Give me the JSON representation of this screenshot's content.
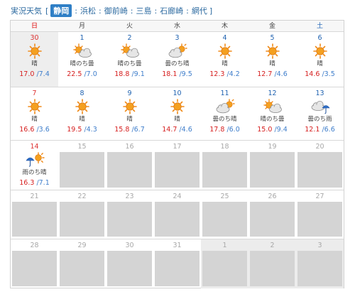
{
  "topbar": {
    "title": "実況天気",
    "open_bracket": "[",
    "close_bracket": "]",
    "locations": [
      {
        "label": "静岡",
        "active": true
      },
      {
        "label": "浜松",
        "active": false
      },
      {
        "label": "御前崎",
        "active": false
      },
      {
        "label": "三島",
        "active": false
      },
      {
        "label": "石廊崎",
        "active": false
      },
      {
        "label": "網代",
        "active": false
      }
    ],
    "separator": ":"
  },
  "weekdays": [
    "日",
    "月",
    "火",
    "水",
    "木",
    "金",
    "土"
  ],
  "weeks": [
    [
      {
        "date": "30",
        "icon": "sun",
        "weather": "晴",
        "high": "17.0",
        "low": "/7.4",
        "today": true
      },
      {
        "date": "1",
        "icon": "sun-cloud",
        "weather": "晴のち曇",
        "high": "22.5",
        "low": "/7.0"
      },
      {
        "date": "2",
        "icon": "sun-cloud",
        "weather": "晴のち曇",
        "high": "18.8",
        "low": "/9.1"
      },
      {
        "date": "3",
        "icon": "cloud-sun",
        "weather": "曇のち晴",
        "high": "18.1",
        "low": "/9.5"
      },
      {
        "date": "4",
        "icon": "sun",
        "weather": "晴",
        "high": "12.3",
        "low": "/4.2"
      },
      {
        "date": "5",
        "icon": "sun",
        "weather": "晴",
        "high": "12.7",
        "low": "/4.6"
      },
      {
        "date": "6",
        "icon": "sun",
        "weather": "晴",
        "high": "14.6",
        "low": "/3.5"
      }
    ],
    [
      {
        "date": "7",
        "icon": "sun",
        "weather": "晴",
        "high": "16.6",
        "low": "/3.6"
      },
      {
        "date": "8",
        "icon": "sun",
        "weather": "晴",
        "high": "19.5",
        "low": "/4.3"
      },
      {
        "date": "9",
        "icon": "sun",
        "weather": "晴",
        "high": "15.8",
        "low": "/6.7"
      },
      {
        "date": "10",
        "icon": "sun",
        "weather": "晴",
        "high": "14.7",
        "low": "/4.6"
      },
      {
        "date": "11",
        "icon": "cloud-sun",
        "weather": "曇のち晴",
        "high": "17.8",
        "low": "/6.0"
      },
      {
        "date": "12",
        "icon": "sun-cloud",
        "weather": "晴のち曇",
        "high": "15.0",
        "low": "/9.4"
      },
      {
        "date": "13",
        "icon": "cloud-rain",
        "weather": "曇のち雨",
        "high": "12.1",
        "low": "/6.6"
      }
    ],
    [
      {
        "date": "14",
        "icon": "rain-sun",
        "weather": "雨のち晴",
        "high": "16.3",
        "low": "/7.1"
      },
      {
        "date": "15",
        "future": true
      },
      {
        "date": "16",
        "future": true
      },
      {
        "date": "17",
        "future": true
      },
      {
        "date": "18",
        "future": true
      },
      {
        "date": "19",
        "future": true
      },
      {
        "date": "20",
        "future": true
      }
    ],
    [
      {
        "date": "21",
        "future": true
      },
      {
        "date": "22",
        "future": true
      },
      {
        "date": "23",
        "future": true
      },
      {
        "date": "24",
        "future": true
      },
      {
        "date": "25",
        "future": true
      },
      {
        "date": "26",
        "future": true
      },
      {
        "date": "27",
        "future": true
      }
    ],
    [
      {
        "date": "28",
        "future": true
      },
      {
        "date": "29",
        "future": true
      },
      {
        "date": "30",
        "future": true
      },
      {
        "date": "31",
        "future": true
      },
      {
        "date": "1",
        "future": true,
        "nextMonth": true
      },
      {
        "date": "2",
        "future": true,
        "nextMonth": true
      },
      {
        "date": "3",
        "future": true,
        "nextMonth": true
      }
    ]
  ]
}
